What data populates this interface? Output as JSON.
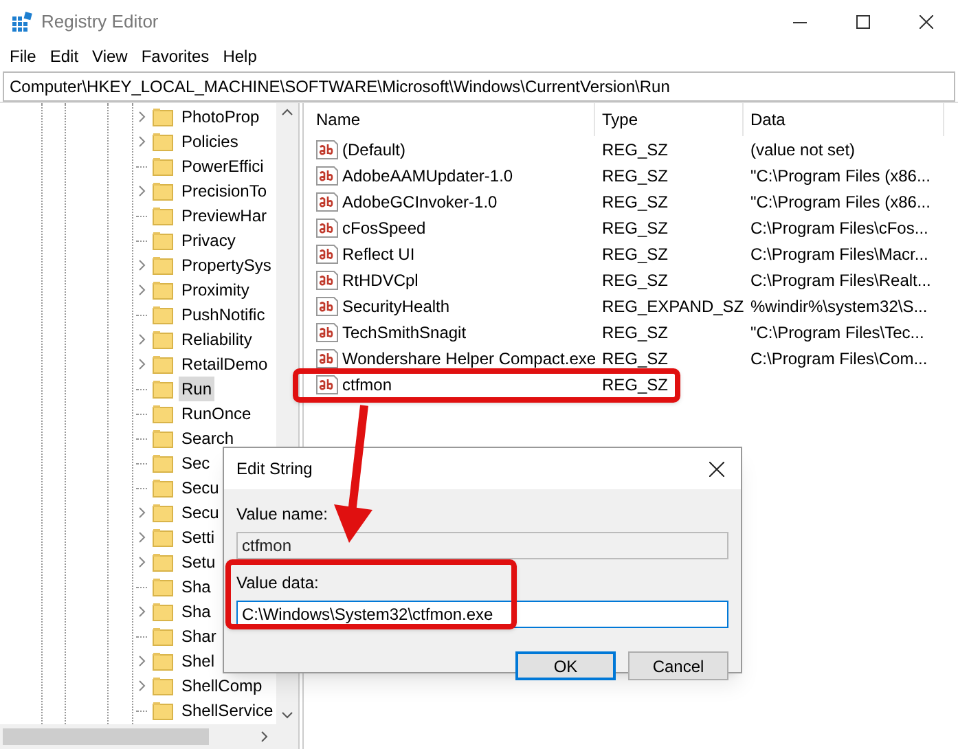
{
  "window": {
    "title": "Registry Editor"
  },
  "menu": [
    "File",
    "Edit",
    "View",
    "Favorites",
    "Help"
  ],
  "address": "Computer\\HKEY_LOCAL_MACHINE\\SOFTWARE\\Microsoft\\Windows\\CurrentVersion\\Run",
  "tree": [
    {
      "label": "PhotoProp",
      "expandable": true,
      "selected": false
    },
    {
      "label": "Policies",
      "expandable": true,
      "selected": false
    },
    {
      "label": "PowerEffici",
      "expandable": false,
      "selected": false
    },
    {
      "label": "PrecisionTo",
      "expandable": true,
      "selected": false
    },
    {
      "label": "PreviewHar",
      "expandable": false,
      "selected": false
    },
    {
      "label": "Privacy",
      "expandable": false,
      "selected": false
    },
    {
      "label": "PropertySys",
      "expandable": true,
      "selected": false
    },
    {
      "label": "Proximity",
      "expandable": true,
      "selected": false
    },
    {
      "label": "PushNotific",
      "expandable": false,
      "selected": false
    },
    {
      "label": "Reliability",
      "expandable": true,
      "selected": false
    },
    {
      "label": "RetailDemo",
      "expandable": true,
      "selected": false
    },
    {
      "label": "Run",
      "expandable": false,
      "selected": true
    },
    {
      "label": "RunOnce",
      "expandable": false,
      "selected": false
    },
    {
      "label": "Search",
      "expandable": false,
      "selected": false
    },
    {
      "label": "Sec",
      "expandable": false,
      "selected": false
    },
    {
      "label": "Secu",
      "expandable": false,
      "selected": false
    },
    {
      "label": "Secu",
      "expandable": true,
      "selected": false
    },
    {
      "label": "Setti",
      "expandable": true,
      "selected": false
    },
    {
      "label": "Setu",
      "expandable": true,
      "selected": false
    },
    {
      "label": "Sha",
      "expandable": false,
      "selected": false
    },
    {
      "label": "Sha",
      "expandable": true,
      "selected": false
    },
    {
      "label": "Shar",
      "expandable": false,
      "selected": false
    },
    {
      "label": "Shel",
      "expandable": true,
      "selected": false
    },
    {
      "label": "ShellComp",
      "expandable": true,
      "selected": false
    },
    {
      "label": "ShellService",
      "expandable": false,
      "selected": false
    }
  ],
  "values": {
    "columns": [
      "Name",
      "Type",
      "Data"
    ],
    "rows": [
      {
        "name": "(Default)",
        "type": "REG_SZ",
        "data": "(value not set)",
        "highlighted": false
      },
      {
        "name": "AdobeAAMUpdater-1.0",
        "type": "REG_SZ",
        "data": "\"C:\\Program Files (x86...",
        "highlighted": false
      },
      {
        "name": "AdobeGCInvoker-1.0",
        "type": "REG_SZ",
        "data": "\"C:\\Program Files (x86...",
        "highlighted": false
      },
      {
        "name": "cFosSpeed",
        "type": "REG_SZ",
        "data": "C:\\Program Files\\cFos...",
        "highlighted": false
      },
      {
        "name": "Reflect UI",
        "type": "REG_SZ",
        "data": "C:\\Program Files\\Macr...",
        "highlighted": false
      },
      {
        "name": "RtHDVCpl",
        "type": "REG_SZ",
        "data": "C:\\Program Files\\Realt...",
        "highlighted": false
      },
      {
        "name": "SecurityHealth",
        "type": "REG_EXPAND_SZ",
        "data": "%windir%\\system32\\S...",
        "highlighted": false
      },
      {
        "name": "TechSmithSnagit",
        "type": "REG_SZ",
        "data": "\"C:\\Program Files\\Tec...",
        "highlighted": false
      },
      {
        "name": "Wondershare Helper Compact.exe",
        "type": "REG_SZ",
        "data": "C:\\Program Files\\Com...",
        "highlighted": false
      },
      {
        "name": "ctfmon",
        "type": "REG_SZ",
        "highlighted": true
      }
    ]
  },
  "dialog": {
    "title": "Edit String",
    "fields": [
      {
        "label": "Value name:",
        "value": "ctfmon",
        "disabled": true,
        "highlighted": false
      },
      {
        "label": "Value data:",
        "value": "C:\\Windows\\System32\\ctfmon.exe",
        "disabled": false,
        "highlighted": true
      }
    ],
    "buttons": [
      {
        "label": "OK",
        "default": true
      },
      {
        "label": "Cancel",
        "default": false
      }
    ]
  }
}
